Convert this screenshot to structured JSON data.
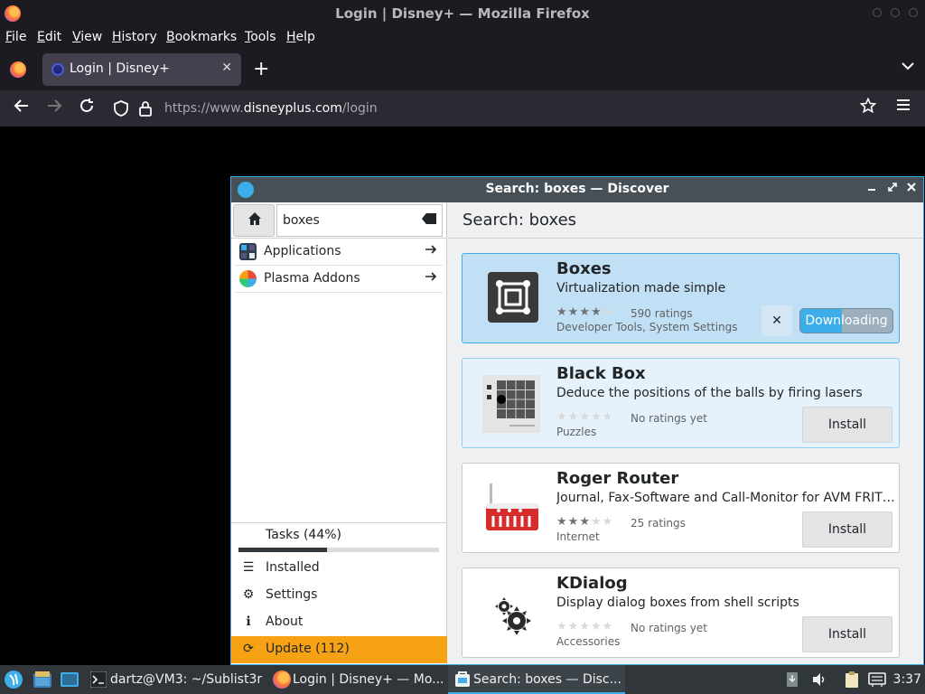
{
  "browser": {
    "window_title": "Login | Disney+ — Mozilla Firefox",
    "menu": [
      "File",
      "Edit",
      "View",
      "History",
      "Bookmarks",
      "Tools",
      "Help"
    ],
    "tab_title": "Login | Disney+",
    "close_tab": "✕",
    "new_tab": "+",
    "list_tabs": "⌄",
    "url_prefix": "https://www.",
    "url_host": "disneyplus.com",
    "url_path": "/login"
  },
  "discover": {
    "window_title": "Search: boxes — Discover",
    "search_value": "boxes",
    "header": "Search: boxes",
    "categories": [
      {
        "label": "Applications"
      },
      {
        "label": "Plasma Addons"
      }
    ],
    "tasks": {
      "label": "Tasks (44%)",
      "progress": 0.44
    },
    "bottom_items": [
      {
        "label": "Installed",
        "icon": "☰"
      },
      {
        "label": "Settings",
        "icon": "⚙"
      },
      {
        "label": "About",
        "icon": "ℹ"
      },
      {
        "label": "Update (112)",
        "icon": "⟳"
      }
    ],
    "results": [
      {
        "name": "Boxes",
        "desc": "Virtualization made simple",
        "rating_stars": 4,
        "ratings": "590 ratings",
        "categories": "Developer Tools, System Settings",
        "action": "Downloading",
        "download_progress": 0.45,
        "cancel": "✕"
      },
      {
        "name": "Black Box",
        "desc": "Deduce the positions of the balls by firing lasers",
        "rating_stars": 0,
        "ratings": "No ratings yet",
        "categories": "Puzzles",
        "action": "Install"
      },
      {
        "name": "Roger Router",
        "desc": "Journal, Fax-Software and Call-Monitor for AVM FRITZ!Box",
        "rating_stars": 3,
        "ratings": "25 ratings",
        "categories": "Internet",
        "action": "Install"
      },
      {
        "name": "KDialog",
        "desc": "Display dialog boxes from shell scripts",
        "rating_stars": 0,
        "ratings": "No ratings yet",
        "categories": "Accessories",
        "action": "Install"
      }
    ]
  },
  "taskbar": {
    "tasks": [
      {
        "label": "dartz@VM3: ~/Sublist3r"
      },
      {
        "label": "Login | Disney+ — Mo..."
      },
      {
        "label": "Search: boxes — Disc..."
      }
    ],
    "clock": "3:37"
  },
  "colors": {
    "accent": "#3daee9",
    "update": "#f6a214",
    "firefox_bg": "#1c1b22"
  }
}
